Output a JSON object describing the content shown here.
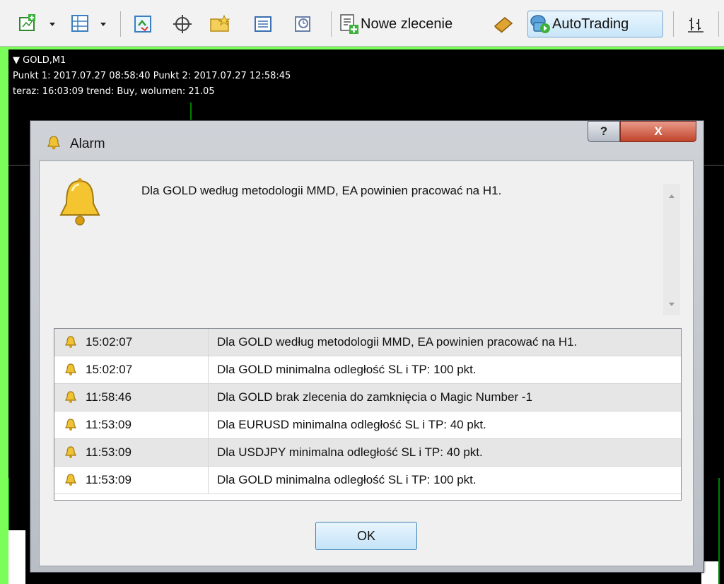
{
  "toolbar": {
    "new_order_label": "Nowe zlecenie",
    "autotrading_label": "AutoTrading"
  },
  "chart": {
    "symbol": "GOLD,M1",
    "line1": "Punkt 1: 2017.07.27 08:58:40  Punkt 2: 2017.07.27 12:58:45",
    "line2": "teraz: 16:03:09  trend: Buy,   wolumen: 21.05"
  },
  "dialog": {
    "title": "Alarm",
    "help_label": "?",
    "close_label": "X",
    "message": "Dla GOLD według metodologii MMD, EA powinien pracować na H1.",
    "ok_label": "OK",
    "rows": [
      {
        "time": "15:02:07",
        "message": "Dla GOLD według metodologii MMD, EA powinien pracować na H1."
      },
      {
        "time": "15:02:07",
        "message": "Dla GOLD minimalna odległość SL i TP: 100 pkt."
      },
      {
        "time": "11:58:46",
        "message": "Dla GOLD brak zlecenia do zamknięcia o Magic Number -1"
      },
      {
        "time": "11:53:09",
        "message": "Dla EURUSD minimalna odległość SL i TP: 40 pkt."
      },
      {
        "time": "11:53:09",
        "message": "Dla USDJPY minimalna odległość SL i TP: 40 pkt."
      },
      {
        "time": "11:53:09",
        "message": "Dla GOLD minimalna odległość SL i TP: 100 pkt."
      }
    ]
  },
  "colors": {
    "chart_background": "#000000",
    "chart_line": "#00ff00",
    "frame_accent": "#7bfd5a",
    "row_alt": "#e6e6e6"
  }
}
